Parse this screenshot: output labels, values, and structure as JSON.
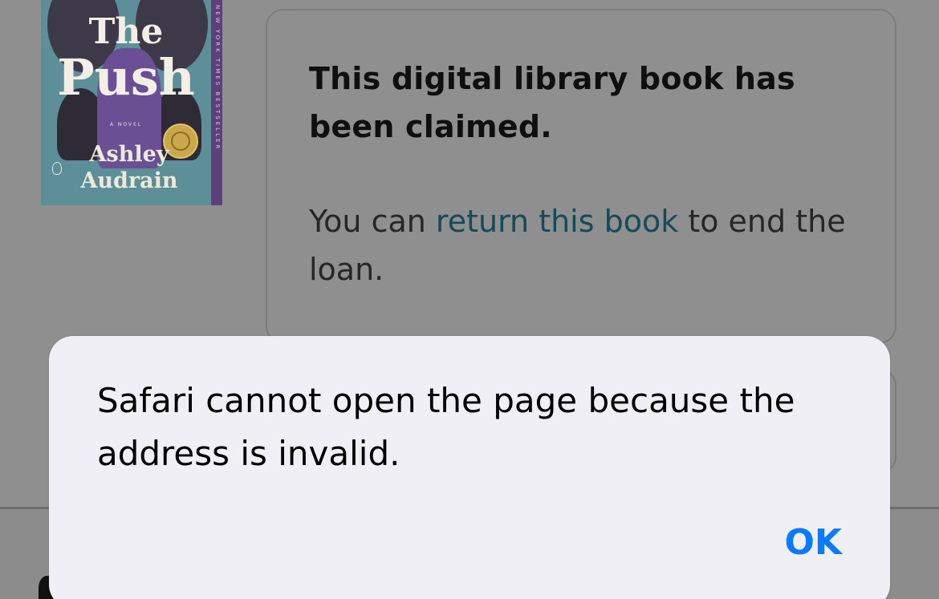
{
  "book": {
    "title_line1": "The",
    "title_line2": "Push",
    "subtitle": "A NOVEL",
    "author_line1": "Ashley",
    "author_line2": "Audrain",
    "spine_text": "NEW YORK TIMES BESTSELLER"
  },
  "card": {
    "title": "This digital library book has been claimed.",
    "body_prefix": "You can ",
    "body_link": "return this book",
    "body_suffix": " to end the loan."
  },
  "alert": {
    "message": "Safari cannot open the page because the address is invalid.",
    "ok_label": "OK"
  },
  "colors": {
    "alert_bg": "#f0eff5",
    "ok_blue": "#0a7aff",
    "link_teal": "#154a58",
    "dim_overlay": "#8f8f8f"
  }
}
